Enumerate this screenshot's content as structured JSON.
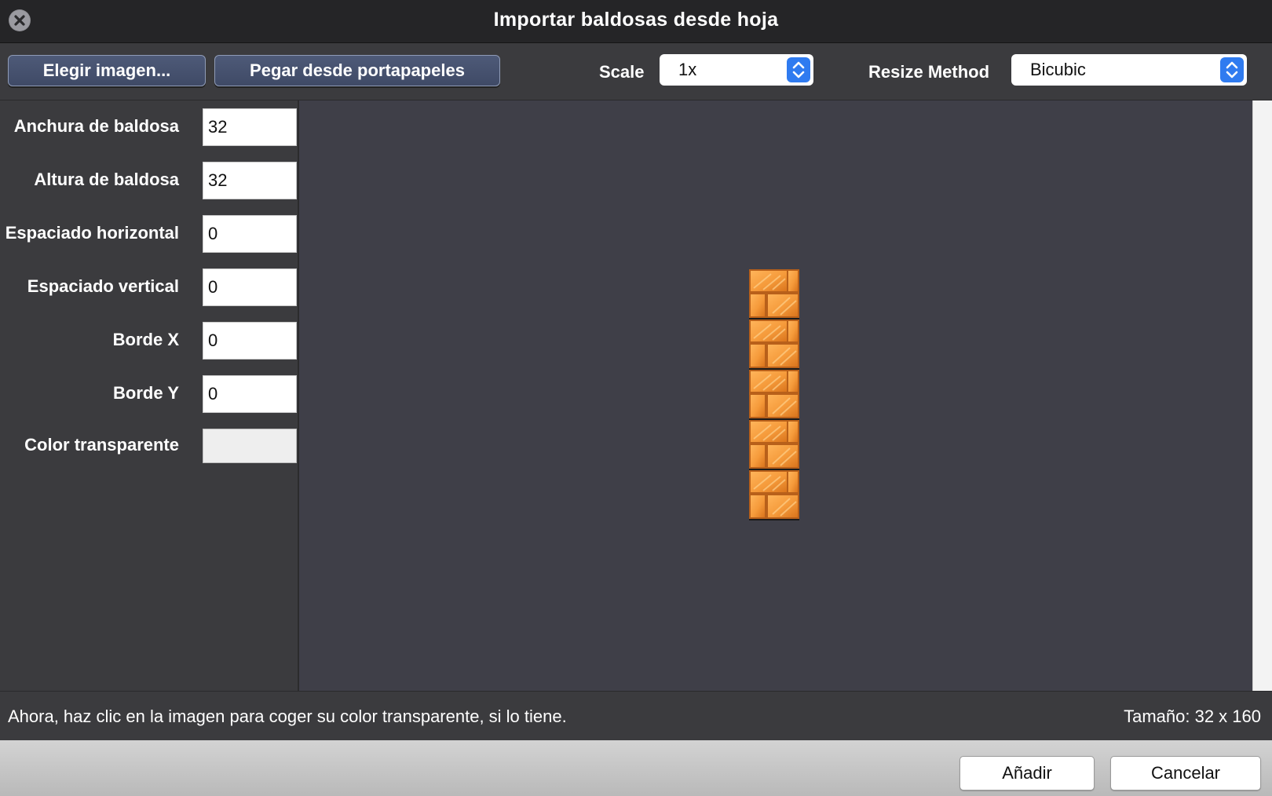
{
  "window": {
    "title": "Importar baldosas desde hoja",
    "close_icon": "close-icon"
  },
  "toolbar": {
    "choose_image_label": "Elegir imagen...",
    "paste_label": "Pegar desde portapapeles",
    "scale_label": "Scale",
    "scale_value": "1x",
    "resize_method_label": "Resize Method",
    "resize_method_value": "Bicubic"
  },
  "settings": {
    "tile_width_label": "Anchura de baldosa",
    "tile_width_value": "32",
    "tile_height_label": "Altura de baldosa",
    "tile_height_value": "32",
    "h_spacing_label": "Espaciado horizontal",
    "h_spacing_value": "0",
    "v_spacing_label": "Espaciado vertical",
    "v_spacing_value": "0",
    "border_x_label": "Borde X",
    "border_x_value": "0",
    "border_y_label": "Borde Y",
    "border_y_value": "0",
    "transparent_color_label": "Color transparente",
    "transparent_color": "#eeeeee"
  },
  "preview": {
    "tile_count": 5,
    "tile_color": "#f59a3a"
  },
  "status": {
    "message": "Ahora, haz clic en la imagen para coger su color transparente, si lo tiene.",
    "size": "Tamaño: 32 x 160"
  },
  "footer": {
    "add_label": "Añadir",
    "cancel_label": "Cancelar"
  }
}
